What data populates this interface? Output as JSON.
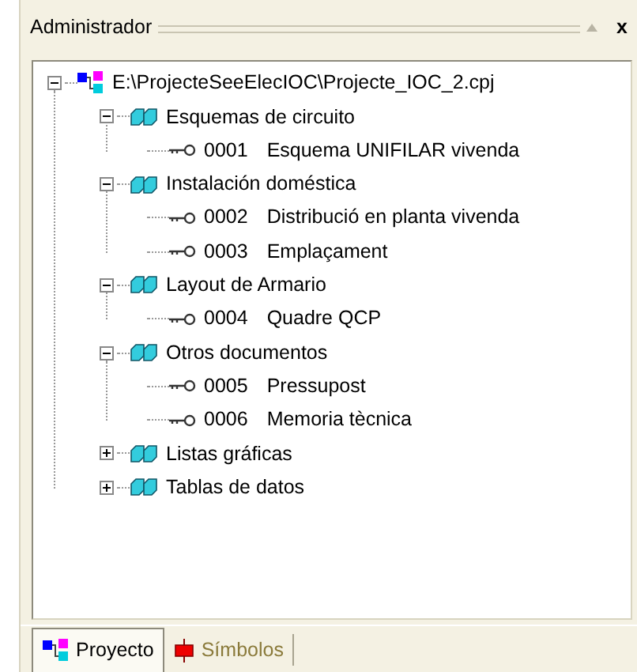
{
  "panel": {
    "title": "Administrador",
    "close": "x"
  },
  "tree": [
    {
      "kind": "project",
      "label": "E:\\ProjecteSeeElecIOC\\Projecte_IOC_2.cpj",
      "expanded": true,
      "children": [
        {
          "kind": "folder",
          "label": "Esquemas de circuito",
          "expanded": true,
          "children": [
            {
              "kind": "document",
              "code": "0001",
              "label": "Esquema UNIFILAR vivenda"
            }
          ]
        },
        {
          "kind": "folder",
          "label": "Instalación doméstica",
          "expanded": true,
          "children": [
            {
              "kind": "document",
              "code": "0002",
              "label": "Distribució en planta vivenda"
            },
            {
              "kind": "document",
              "code": "0003",
              "label": "Emplaçament"
            }
          ]
        },
        {
          "kind": "folder",
          "label": "Layout de Armario",
          "expanded": true,
          "children": [
            {
              "kind": "document",
              "code": "0004",
              "label": "Quadre QCP"
            }
          ]
        },
        {
          "kind": "folder",
          "label": "Otros documentos",
          "expanded": true,
          "children": [
            {
              "kind": "document",
              "code": "0005",
              "label": "Pressupost"
            },
            {
              "kind": "document",
              "code": "0006",
              "label": "Memoria tècnica"
            }
          ]
        },
        {
          "kind": "folder",
          "label": "Listas gráficas",
          "expanded": false
        },
        {
          "kind": "folder",
          "label": "Tablas de datos",
          "expanded": false
        }
      ]
    }
  ],
  "tabs": [
    {
      "kind": "project",
      "label": "Proyecto",
      "selected": true
    },
    {
      "kind": "symbols",
      "label": "Símbolos",
      "selected": false
    }
  ]
}
